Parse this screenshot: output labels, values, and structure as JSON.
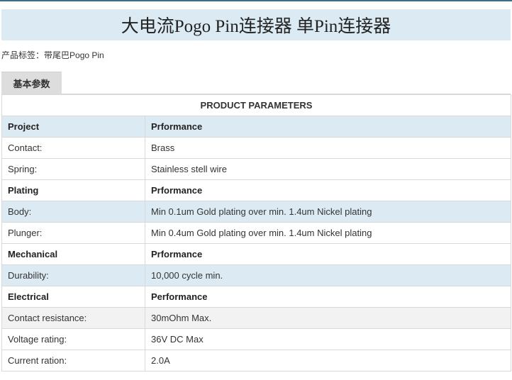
{
  "page": {
    "title": "大电流Pogo Pin连接器 单Pin连接器",
    "tags_label": "产品标签：",
    "tag": "带尾巴Pogo Pin",
    "tab_label": "基本参数"
  },
  "table": {
    "caption": "PRODUCT PARAMETERS",
    "rows": [
      {
        "label": "Project",
        "value": "Prformance",
        "bold": true,
        "bg": "blue"
      },
      {
        "label": "Contact:",
        "value": "Brass",
        "bold": false,
        "bg": "white"
      },
      {
        "label": "Spring:",
        "value": "Stainless stell wire",
        "bold": false,
        "bg": "white"
      },
      {
        "label": "Plating",
        "value": "Prformance",
        "bold": true,
        "bg": "white"
      },
      {
        "label": "Body:",
        "value": "Min 0.1um Gold plating over min. 1.4um Nickel plating",
        "bold": false,
        "bg": "blue"
      },
      {
        "label": "Plunger:",
        "value": "Min 0.4um Gold plating over min. 1.4um Nickel plating",
        "bold": false,
        "bg": "white"
      },
      {
        "label": "Mechanical",
        "value": "Prformance",
        "bold": true,
        "bg": "white"
      },
      {
        "label": "Durability:",
        "value": "10,000 cycle min.",
        "bold": false,
        "bg": "blue"
      },
      {
        "label": "Electrical",
        "value": "Performance",
        "bold": true,
        "bg": "white"
      },
      {
        "label": "Contact resistance:",
        "value": "30mOhm Max.",
        "bold": false,
        "bg": "gray"
      },
      {
        "label": "Voltage rating:",
        "value": "36V DC Max",
        "bold": false,
        "bg": "white"
      },
      {
        "label": "Current ration:",
        "value": "2.0A",
        "bold": false,
        "bg": "white"
      }
    ]
  },
  "colors": {
    "title_bg": "#dcebf3",
    "top_line": "#3b6f86",
    "row_blue": "#dcebf3",
    "row_gray": "#f2f2f2",
    "tab_bg": "#dddddd"
  }
}
